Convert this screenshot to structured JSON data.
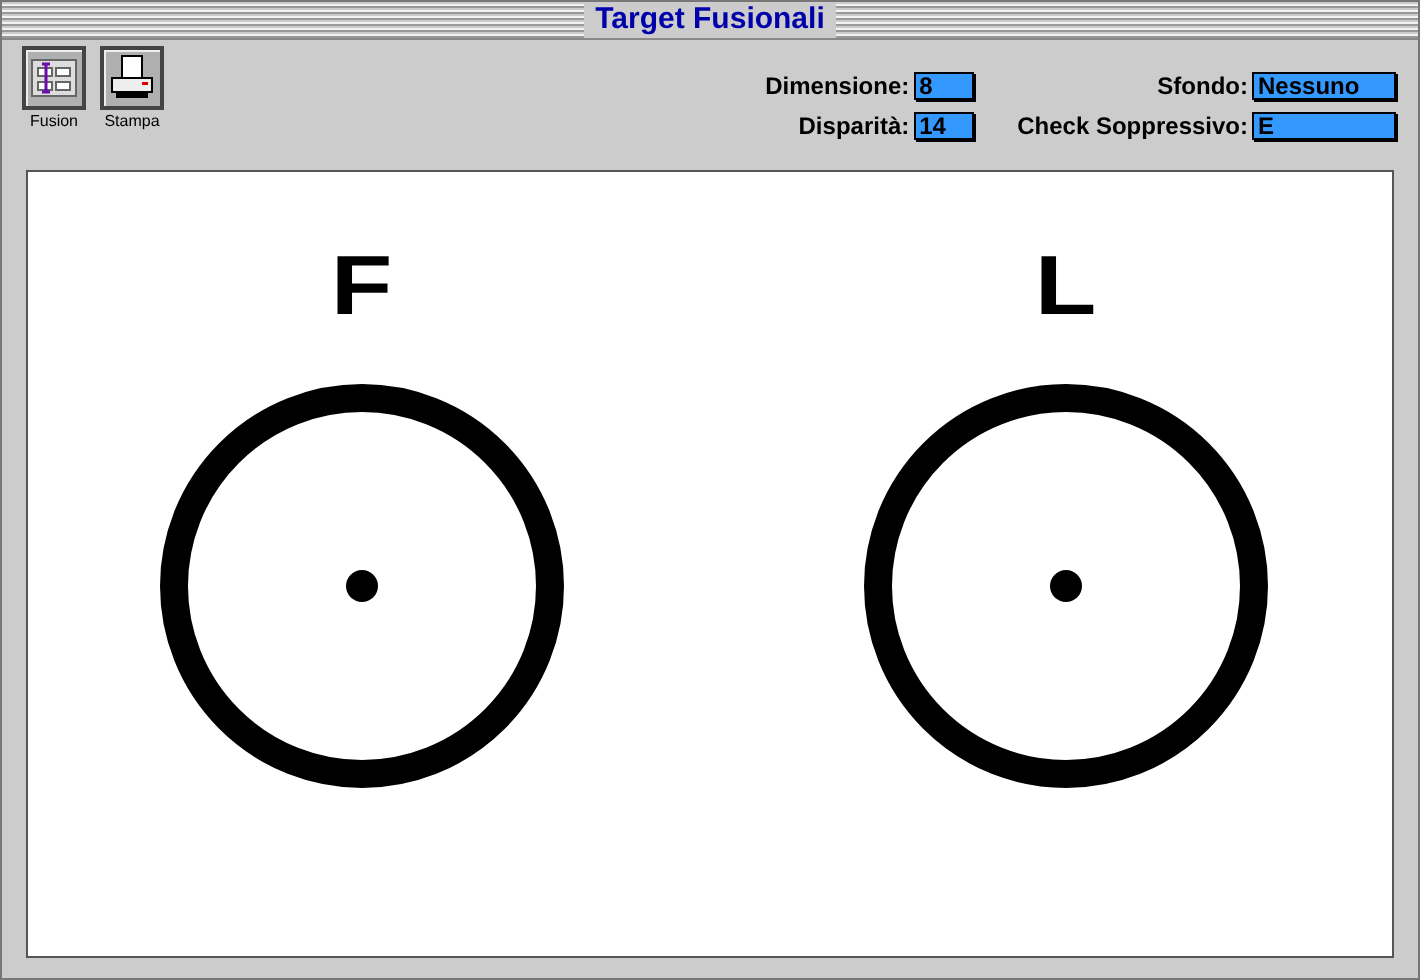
{
  "window": {
    "title": "Target Fusionali"
  },
  "toolbar": [
    {
      "kind": "fusion",
      "label": "Fusion"
    },
    {
      "kind": "print",
      "label": "Stampa"
    }
  ],
  "fields": [
    {
      "label": "Dimensione:",
      "value": "8"
    },
    {
      "label": "Sfondo:",
      "value": "Nessuno"
    },
    {
      "label": "Disparità:",
      "value": "14"
    },
    {
      "label": "Check Soppressivo:",
      "value": "E"
    }
  ],
  "targets": [
    {
      "letter": "F"
    },
    {
      "letter": "L"
    }
  ]
}
